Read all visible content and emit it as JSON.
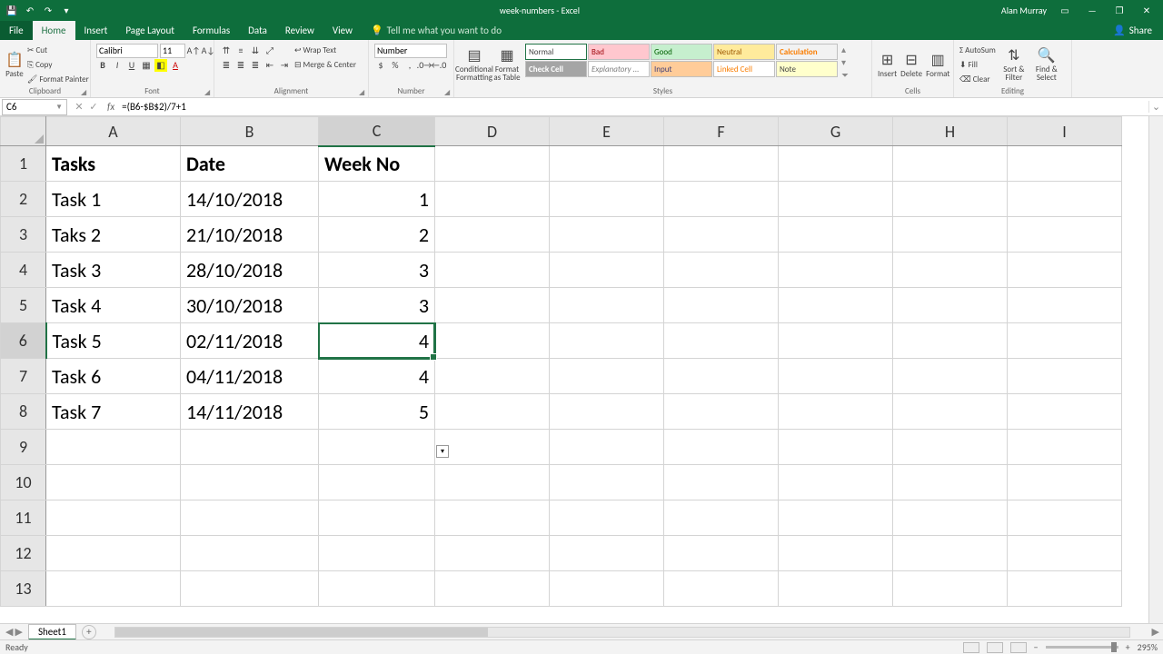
{
  "app": {
    "workbook_name": "week-numbers",
    "app_name": "Excel",
    "user_name": "Alan Murray"
  },
  "tabs": {
    "file": "File",
    "home": "Home",
    "insert": "Insert",
    "page_layout": "Page Layout",
    "formulas": "Formulas",
    "data": "Data",
    "review": "Review",
    "view": "View",
    "tell_me": "Tell me what you want to do",
    "share": "Share"
  },
  "ribbon": {
    "clipboard": {
      "label": "Clipboard",
      "paste": "Paste",
      "cut": "Cut",
      "copy": "Copy",
      "format_painter": "Format Painter"
    },
    "font": {
      "label": "Font",
      "name": "Calibri",
      "size": "11"
    },
    "alignment": {
      "label": "Alignment",
      "wrap": "Wrap Text",
      "merge": "Merge & Center"
    },
    "number": {
      "label": "Number",
      "format": "Number"
    },
    "styles": {
      "label": "Styles",
      "conditional": "Conditional Formatting",
      "format_table": "Format as Table",
      "cells": {
        "normal": "Normal",
        "bad": "Bad",
        "good": "Good",
        "neutral": "Neutral",
        "calculation": "Calculation",
        "check": "Check Cell",
        "explan": "Explanatory ...",
        "input": "Input",
        "linked": "Linked Cell",
        "note": "Note"
      }
    },
    "cells_grp": {
      "label": "Cells",
      "insert": "Insert",
      "delete": "Delete",
      "format": "Format"
    },
    "editing": {
      "label": "Editing",
      "autosum": "AutoSum",
      "fill": "Fill",
      "clear": "Clear",
      "sort": "Sort & Filter",
      "find": "Find & Select"
    }
  },
  "formula_bar": {
    "name_box": "C6",
    "formula": "=(B6-$B$2)/7+1"
  },
  "columns": [
    "A",
    "B",
    "C",
    "D",
    "E",
    "F",
    "G",
    "H",
    "I"
  ],
  "headers": {
    "tasks": "Tasks",
    "date": "Date",
    "weekno": "Week No"
  },
  "rows": [
    {
      "task": "Task 1",
      "date": "14/10/2018",
      "week": "1"
    },
    {
      "task": "Taks 2",
      "date": "21/10/2018",
      "week": "2"
    },
    {
      "task": "Task 3",
      "date": "28/10/2018",
      "week": "3"
    },
    {
      "task": "Task 4",
      "date": "30/10/2018",
      "week": "3"
    },
    {
      "task": "Task 5",
      "date": "02/11/2018",
      "week": "4"
    },
    {
      "task": "Task 6",
      "date": "04/11/2018",
      "week": "4"
    },
    {
      "task": "Task 7",
      "date": "14/11/2018",
      "week": "5"
    }
  ],
  "active_cell": "C6",
  "sheet": {
    "name": "Sheet1"
  },
  "status": {
    "ready": "Ready",
    "zoom": "295%"
  }
}
